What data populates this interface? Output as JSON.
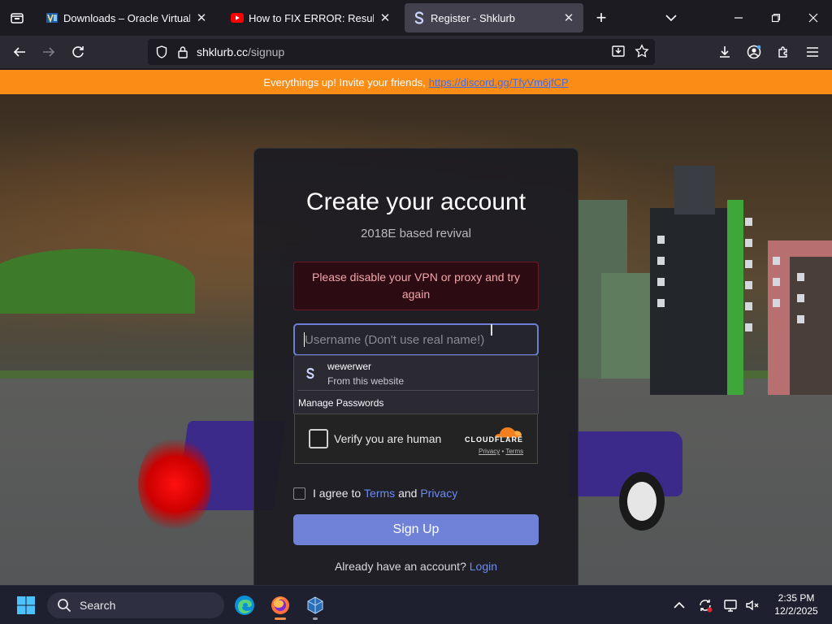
{
  "browser": {
    "tabs": [
      {
        "title": "Downloads – Oracle VirtualBox",
        "favicon": "virtualbox-icon",
        "active": false
      },
      {
        "title": "How to FIX ERROR: Result Code",
        "favicon": "youtube-icon",
        "active": false
      },
      {
        "title": "Register - Shklurb",
        "favicon": "shklurb-icon",
        "active": true
      }
    ],
    "url_host": "shklurb.cc",
    "url_path": "/signup"
  },
  "banner": {
    "text": "Everythings up! Invite your friends,",
    "link": "https://discord.gg/TfyVm6jfCP"
  },
  "signup": {
    "title": "Create your account",
    "subtitle": "2018E based revival",
    "alert": "Please disable your VPN or proxy and try again",
    "username_placeholder": "Username (Don't use real name!)",
    "autocomplete": {
      "username": "wewerwer",
      "source": "From this website",
      "manage": "Manage Passwords"
    },
    "captcha": {
      "label": "Verify you are human",
      "brand": "CLOUDFLARE",
      "privacy": "Privacy",
      "terms": "Terms"
    },
    "agree_prefix": "I agree to",
    "agree_terms": "Terms",
    "agree_and": "and",
    "agree_privacy": "Privacy",
    "submit": "Sign Up",
    "login_prompt": "Already have an account?",
    "login_link": "Login"
  },
  "taskbar": {
    "search": "Search",
    "time": "2:35 PM",
    "date": "12/2/2025"
  },
  "colors": {
    "banner": "#fb8c15",
    "accent": "#6f82d8",
    "link": "#6b8cf0",
    "alert_bg": "#2c0b12"
  }
}
